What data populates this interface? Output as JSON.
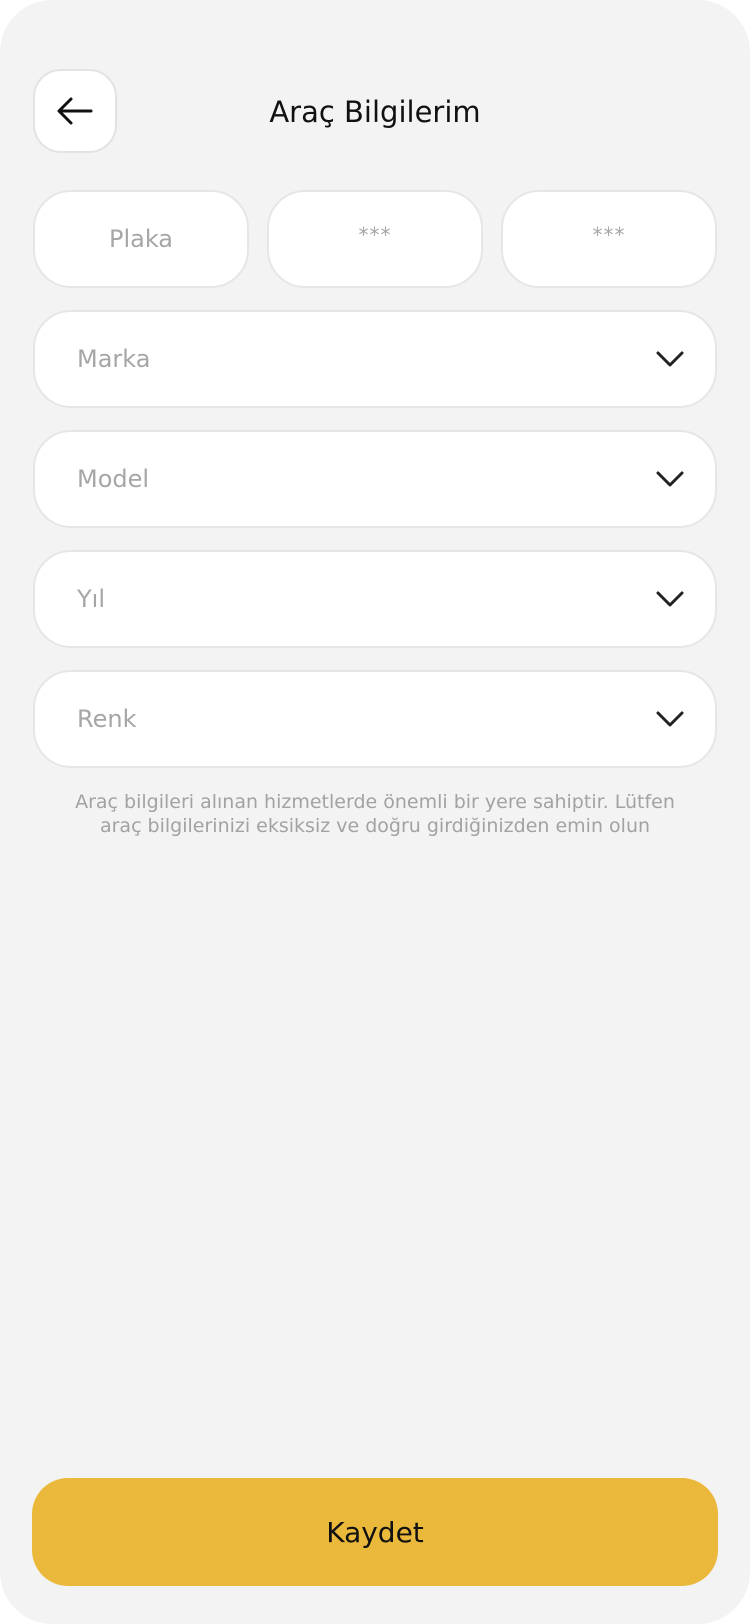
{
  "header": {
    "title": "Araç Bilgilerim",
    "back_icon": "arrow-left-icon"
  },
  "plate": {
    "label": "Plaka",
    "part2_placeholder": "***",
    "part3_placeholder": "***"
  },
  "fields": {
    "brand": {
      "label": "Marka",
      "icon": "chevron-down-icon"
    },
    "model": {
      "label": "Model",
      "icon": "chevron-down-icon"
    },
    "year": {
      "label": "Yıl",
      "icon": "chevron-down-icon"
    },
    "color": {
      "label": "Renk",
      "icon": "chevron-down-icon"
    }
  },
  "hint": "Araç bilgileri alınan hizmetlerde önemli bir yere sahiptir. Lütfen araç bilgilerinizi eksiksiz ve doğru girdiğinizden emin olun",
  "save_button": {
    "label": "Kaydet",
    "color": "#eab83a"
  },
  "colors": {
    "background": "#f3f3f3",
    "card": "#ffffff",
    "border": "#e6e6e6",
    "placeholder": "#a6a6a6",
    "text": "#111111"
  }
}
